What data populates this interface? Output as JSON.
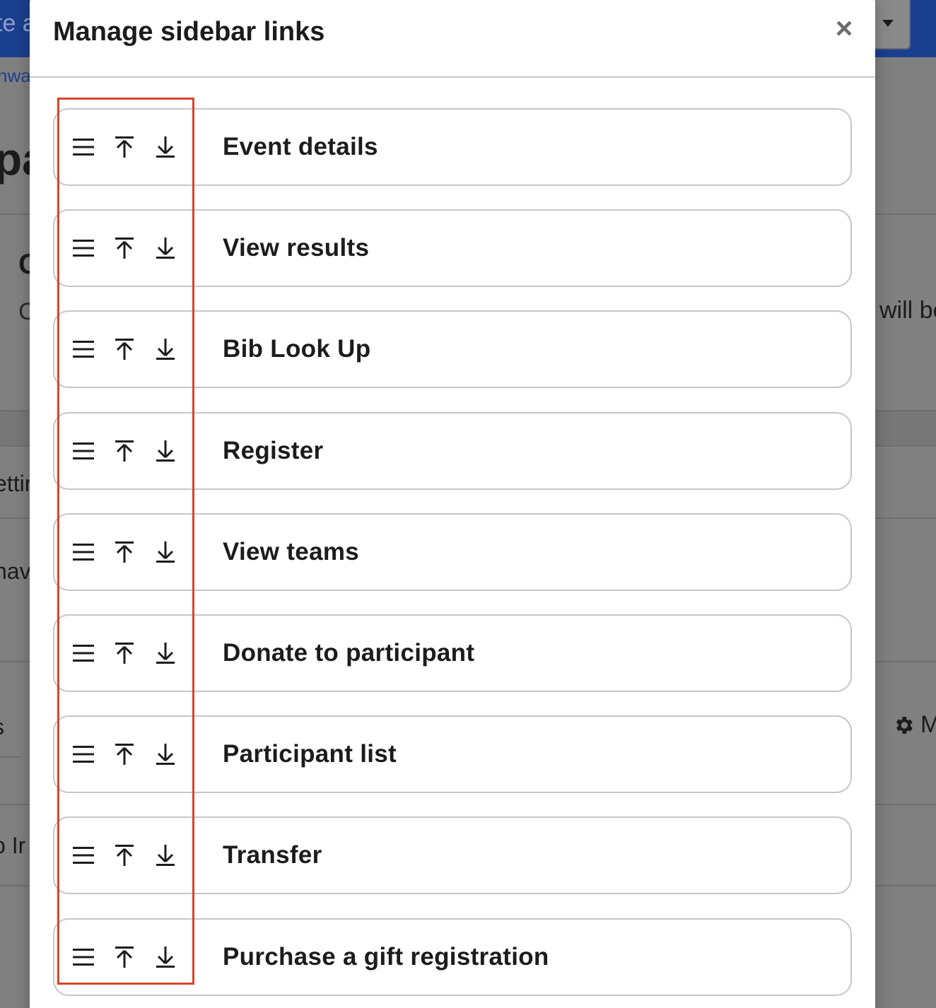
{
  "background": {
    "topbar_left_text": "te a",
    "breadcrumb_fragment": "nwa",
    "heading_fragment": "pa",
    "section_heading_fragment": "C",
    "section_text_fragment": "C",
    "right_text_fragment": "will be",
    "left_text_1": "ettir",
    "left_text_2": "nav",
    "left_text_3": "s",
    "left_text_4": "p Ir",
    "manage_button_fragment": "M"
  },
  "modal": {
    "title": "Manage sidebar links",
    "close_symbol": "×"
  },
  "links": [
    {
      "label": "Event details"
    },
    {
      "label": "View results"
    },
    {
      "label": "Bib Look Up"
    },
    {
      "label": "Register"
    },
    {
      "label": "View teams"
    },
    {
      "label": "Donate to participant"
    },
    {
      "label": "Participant list"
    },
    {
      "label": "Transfer"
    },
    {
      "label": "Purchase a gift registration"
    }
  ],
  "icons": {
    "drag": "drag-handle-icon",
    "move_top": "move-to-top-icon",
    "move_bottom": "move-to-bottom-icon",
    "close": "close-icon",
    "settings": "gear-icon"
  },
  "colors": {
    "topbar": "#1b3f8f",
    "highlight": "#d9442b",
    "row_border": "#c6c6c6",
    "text": "#1c1c1c"
  }
}
